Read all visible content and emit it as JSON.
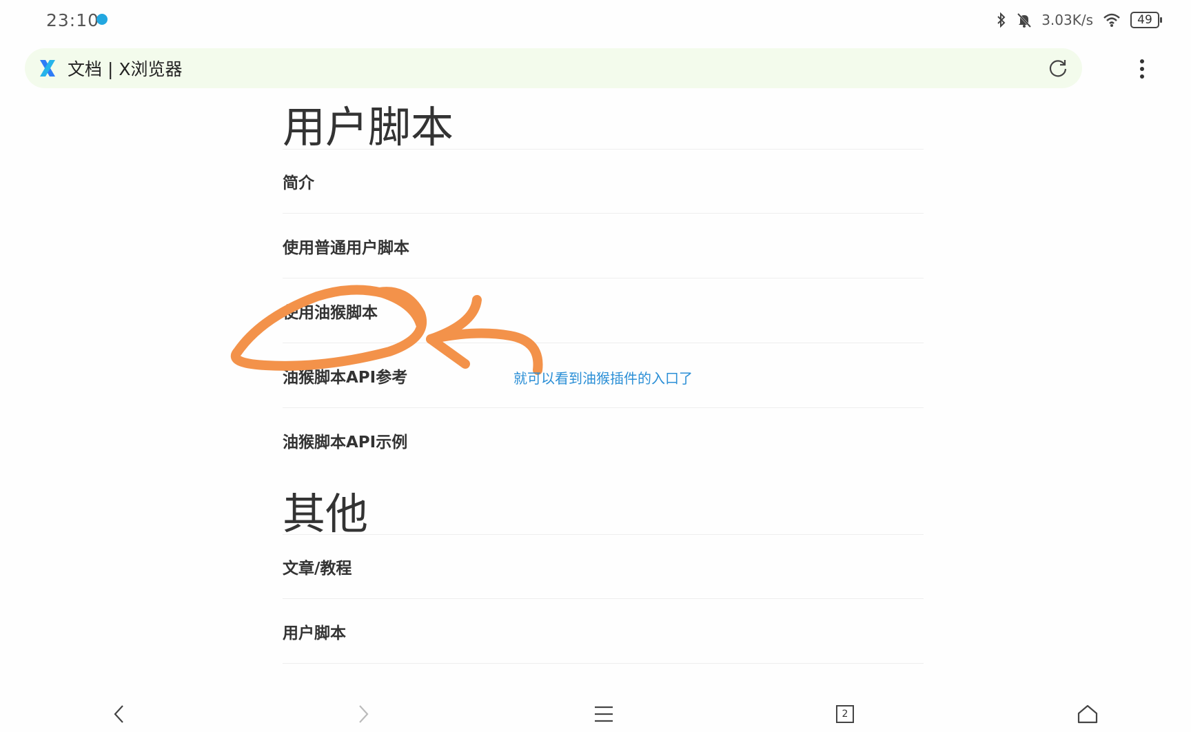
{
  "status_bar": {
    "time": "23:10",
    "net_speed": "3.03K/s",
    "battery": "49",
    "icons": [
      "bluetooth-icon",
      "mute-bell-icon",
      "wifi-icon",
      "battery-icon"
    ]
  },
  "address_bar": {
    "title": "文档 | X浏览器",
    "brand_icon": "x-browser-logo-icon",
    "reload_icon": "reload-icon",
    "menu_icon": "more-vertical-icon"
  },
  "sections": [
    {
      "heading": "用户脚本",
      "items": [
        "简介",
        "使用普通用户脚本",
        "使用油猴脚本",
        "油猴脚本API参考",
        "油猴脚本API示例"
      ]
    },
    {
      "heading": "其他",
      "items": [
        "文章/教程",
        "用户脚本"
      ]
    }
  ],
  "annotation": {
    "text": "就可以看到油猴插件的入口了",
    "stroke_color": "#f3924a"
  },
  "bottom_bar": {
    "tab_count": "2",
    "icons": [
      "back-icon",
      "forward-icon",
      "hamburger-menu-icon",
      "tabs-icon",
      "home-icon"
    ]
  }
}
